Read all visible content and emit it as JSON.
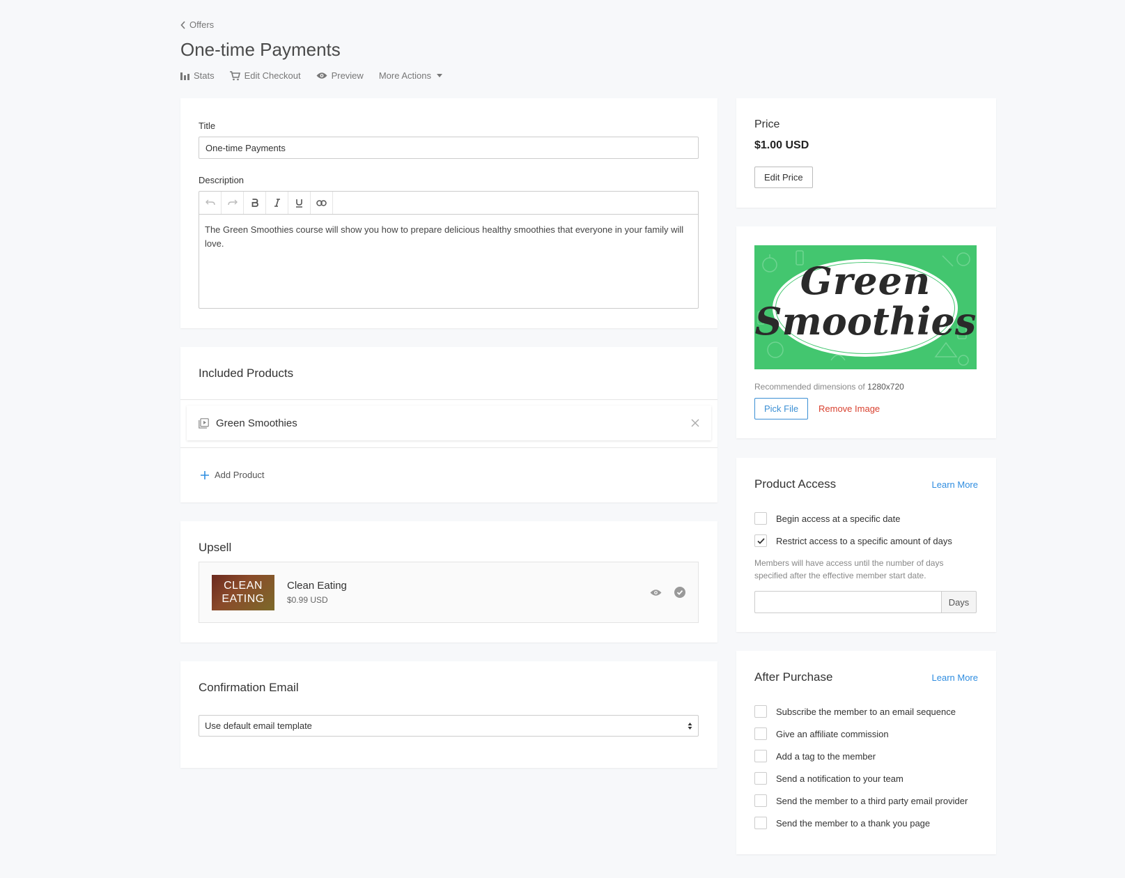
{
  "nav": {
    "back_label": "Offers"
  },
  "header": {
    "title": "One-time Payments",
    "actions": {
      "stats": "Stats",
      "edit_checkout": "Edit Checkout",
      "preview": "Preview",
      "more_actions": "More Actions"
    }
  },
  "details": {
    "title_label": "Title",
    "title_value": "One-time Payments",
    "description_label": "Description",
    "description_text": "The Green Smoothies course will show you how to prepare delicious healthy smoothies that everyone in your family will love."
  },
  "included_products": {
    "title": "Included Products",
    "items": [
      {
        "name": "Green Smoothies"
      }
    ],
    "add_label": "Add Product"
  },
  "upsell": {
    "title": "Upsell",
    "item": {
      "thumb_line1": "CLEAN",
      "thumb_line2": "EATING",
      "name": "Clean Eating",
      "price": "$0.99 USD"
    }
  },
  "confirmation": {
    "title": "Confirmation Email",
    "selected": "Use default email template"
  },
  "price": {
    "label": "Price",
    "value": "$1.00 USD",
    "edit_label": "Edit Price"
  },
  "image": {
    "banner_line1": "Green",
    "banner_line2": "Smoothies",
    "hint_prefix": "Recommended dimensions of",
    "hint_dims": "1280x720",
    "pick_label": "Pick File",
    "remove_label": "Remove Image"
  },
  "product_access": {
    "title": "Product Access",
    "learn_more": "Learn More",
    "options": [
      {
        "label": "Begin access at a specific date",
        "checked": false
      },
      {
        "label": "Restrict access to a specific amount of days",
        "checked": true
      }
    ],
    "hint": "Members will have access until the number of days specified after the effective member start date.",
    "days_value": "",
    "days_addon": "Days"
  },
  "after_purchase": {
    "title": "After Purchase",
    "learn_more": "Learn More",
    "options": [
      {
        "label": "Subscribe the member to an email sequence",
        "checked": false
      },
      {
        "label": "Give an affiliate commission",
        "checked": false
      },
      {
        "label": "Add a tag to the member",
        "checked": false
      },
      {
        "label": "Send a notification to your team",
        "checked": false
      },
      {
        "label": "Send the member to a third party email provider",
        "checked": false
      },
      {
        "label": "Send the member to a thank you page",
        "checked": false
      }
    ]
  },
  "colors": {
    "accent": "#2f8de0",
    "danger": "#d9412f",
    "banner_green": "#43c66f"
  }
}
